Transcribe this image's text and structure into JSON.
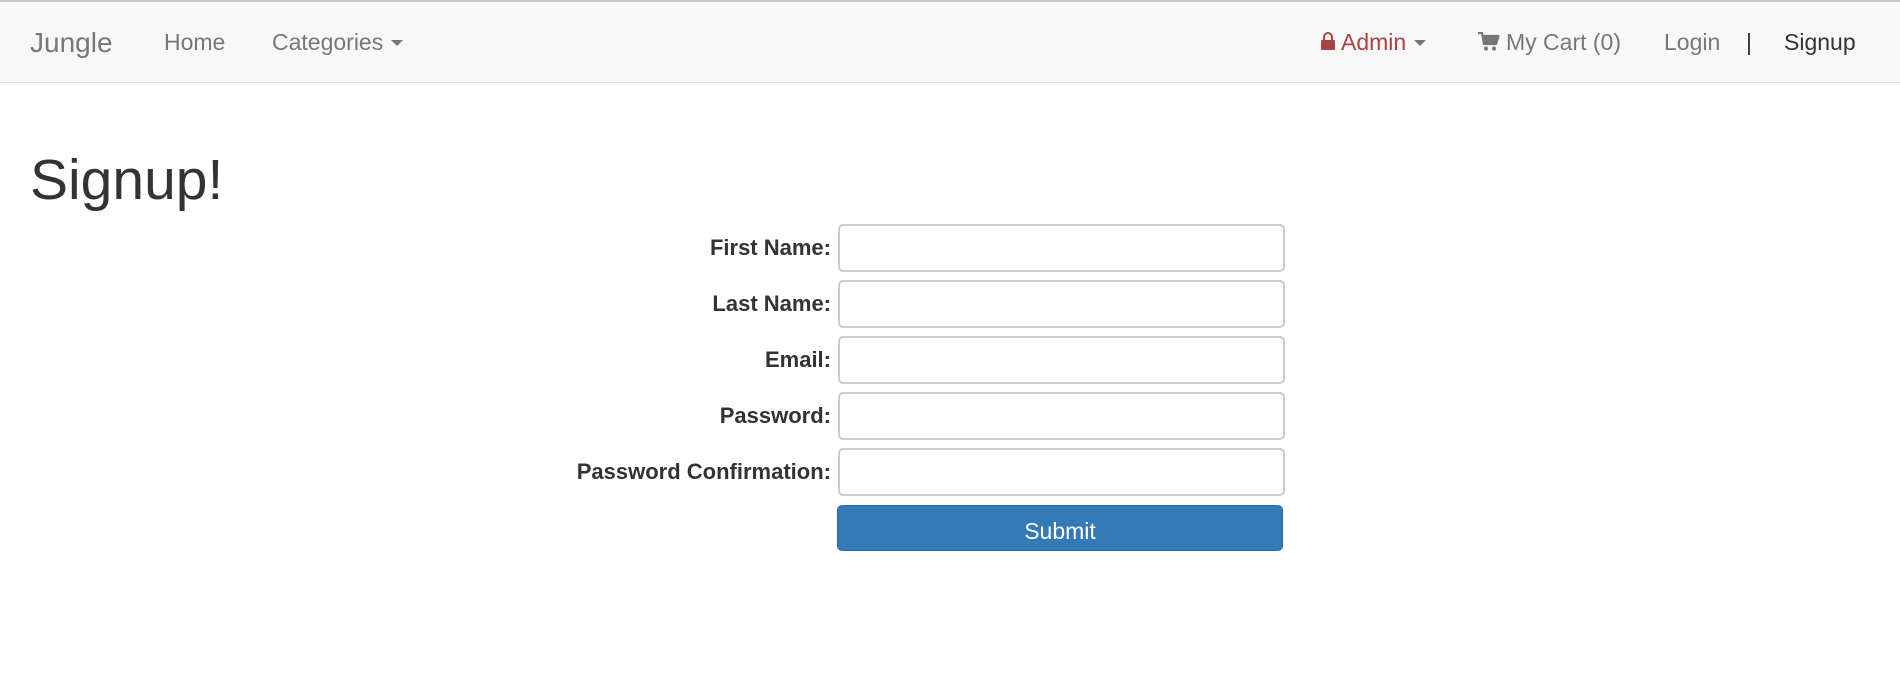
{
  "navbar": {
    "brand": "Jungle",
    "home": "Home",
    "categories": "Categories",
    "admin": "Admin",
    "cart": "My Cart (0)",
    "login": "Login",
    "divider": "|",
    "signup": "Signup"
  },
  "icons": {
    "admin": "lock-icon",
    "cart": "cart-icon",
    "dropdown": "caret-down-icon"
  },
  "colors": {
    "navbar_bg": "#f8f8f8",
    "admin_accent": "#a94442",
    "primary_button": "#337ab7"
  },
  "page": {
    "title": "Signup!"
  },
  "form": {
    "fields": [
      {
        "label": "First Name:",
        "value": "",
        "placeholder": ""
      },
      {
        "label": "Last Name:",
        "value": "",
        "placeholder": ""
      },
      {
        "label": "Email:",
        "value": "",
        "placeholder": ""
      },
      {
        "label": "Password:",
        "value": "",
        "placeholder": ""
      },
      {
        "label": "Password Confirmation:",
        "value": "",
        "placeholder": ""
      }
    ],
    "submit_label": "Submit"
  }
}
